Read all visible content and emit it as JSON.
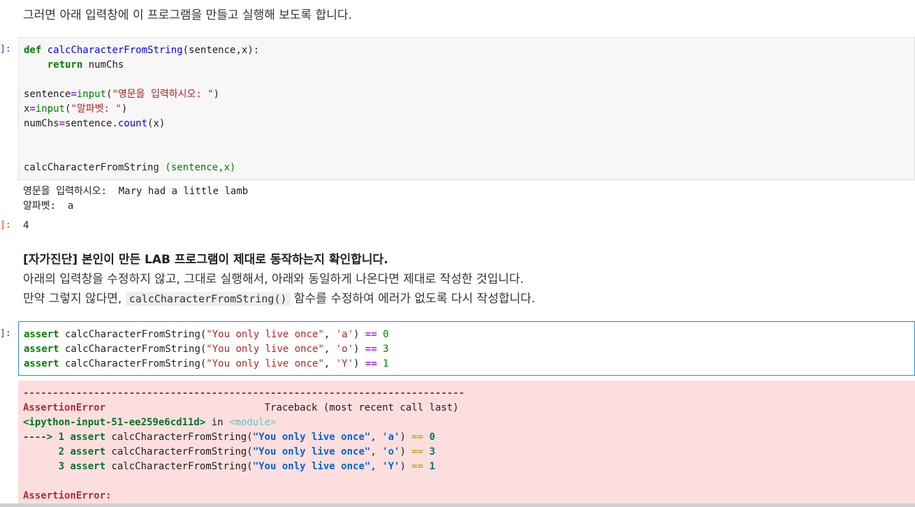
{
  "intro_text": "그러면 아래 입력창에 이 프로그램을 만들고 실행해 보도록 합니다.",
  "prompts": {
    "cell1_in": "]:",
    "cell1_out": "]:",
    "cell2_in": "]:"
  },
  "cell1": {
    "l1_def": "def",
    "l1_name": "calcCharacterFromString",
    "l1_args": "(sentence,x):",
    "l2_return": "return",
    "l2_val": "numChs",
    "l4_var": "sentence",
    "l4_eq": "=",
    "l4_fn": "input",
    "l4_open": "(",
    "l4_str": "\"영문을 입력하시오: \"",
    "l4_close": ")",
    "l5_var": "x",
    "l5_eq": "=",
    "l5_fn": "input",
    "l5_open": "(",
    "l5_str": "\"알파벳: \"",
    "l5_close": ")",
    "l6_var": "numChs",
    "l6_eq": "=",
    "l6_obj": "sentence.",
    "l6_method": "count",
    "l6_args": "(x)",
    "l9_call": "calcCharacterFromString ",
    "l9_args": "(sentence,x)"
  },
  "cell1_stdout": {
    "line1": "영문을 입력하시오:  Mary had a little lamb",
    "line2": "알파벳:  a"
  },
  "cell1_result": "4",
  "selfcheck": {
    "title": "[자가진단] 본인이 만든 LAB 프로그램이 제대로 동작하는지 확인합니다.",
    "line1": "아래의 입력창을 수정하지 않고, 그대로 실행해서, 아래와 동일하게 나온다면 제대로 작성한 것입니다.",
    "line2_pre": "만약 그렇지 않다면, ",
    "line2_code": "calcCharacterFromString()",
    "line2_post": " 함수를 수정하여 에러가 없도록 다시 작성합니다."
  },
  "cell2": {
    "lines": [
      {
        "kw": "assert",
        "call": " calcCharacterFromString(",
        "str": "\"You only live once\"",
        "comma": ", ",
        "ch": "'a'",
        "close": ") ",
        "op": "==",
        "num": " 0"
      },
      {
        "kw": "assert",
        "call": " calcCharacterFromString(",
        "str": "\"You only live once\"",
        "comma": ", ",
        "ch": "'o'",
        "close": ") ",
        "op": "==",
        "num": " 3"
      },
      {
        "kw": "assert",
        "call": " calcCharacterFromString(",
        "str": "\"You only live once\"",
        "comma": ", ",
        "ch": "'Y'",
        "close": ") ",
        "op": "==",
        "num": " 1"
      }
    ]
  },
  "error": {
    "separator": "---------------------------------------------------------------------------",
    "type": "AssertionError",
    "traceback_label": "                           Traceback (most recent call last)",
    "input_ref": "<ipython-input-51-ee259e6cd11d>",
    "in_word": " in ",
    "module": "<module>",
    "frames": [
      {
        "arrow": "----> ",
        "num": "1 ",
        "kw": "assert",
        "call": " calcCharacterFromString(",
        "str": "\"You only live once\"",
        "comma": ", ",
        "ch": "'a'",
        "close": ") ",
        "op": "==",
        "val": " 0"
      },
      {
        "arrow": "      ",
        "num": "2 ",
        "kw": "assert",
        "call": " calcCharacterFromString(",
        "str": "\"You only live once\"",
        "comma": ", ",
        "ch": "'o'",
        "close": ") ",
        "op": "==",
        "val": " 3"
      },
      {
        "arrow": "      ",
        "num": "3 ",
        "kw": "assert",
        "call": " calcCharacterFromString(",
        "str": "\"You only live once\"",
        "comma": ", ",
        "ch": "'Y'",
        "close": ") ",
        "op": "==",
        "val": " 1"
      }
    ],
    "final": "AssertionError:"
  }
}
